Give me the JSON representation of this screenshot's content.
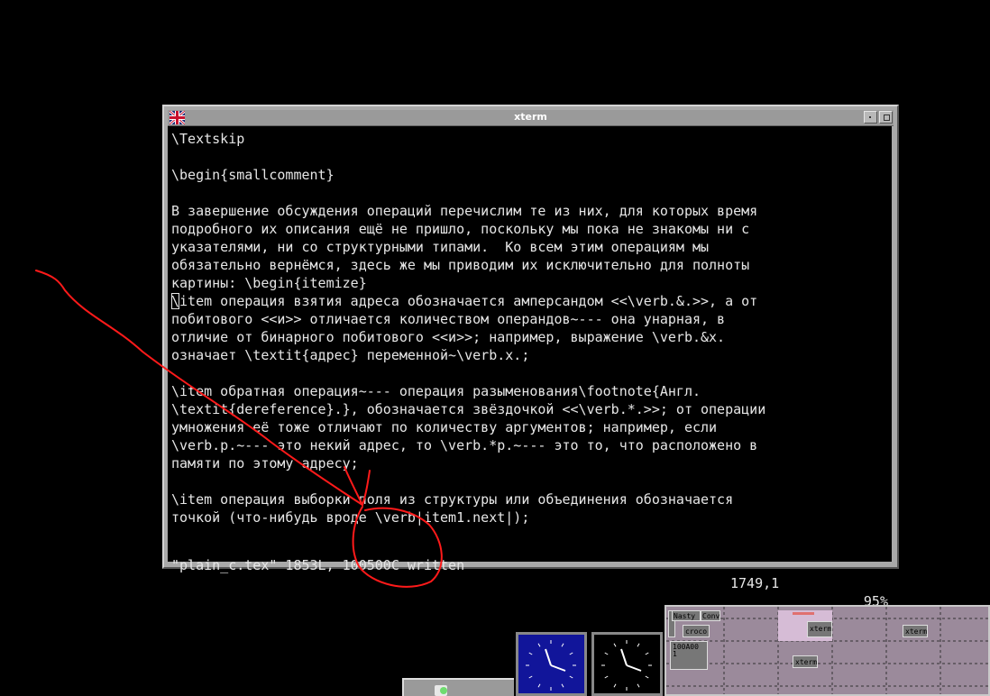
{
  "window": {
    "title": "xterm"
  },
  "terminal": {
    "lines": [
      "\\Textskip",
      "",
      "\\begin{smallcomment}",
      "",
      "В завершение обсуждения операций перечислим те из них, для которых время",
      "подробного их описания ещё не пришло, поскольку мы пока не знакомы ни с",
      "указателями, ни со структурными типами.  Ко всем этим операциям мы",
      "обязательно вернёмся, здесь же мы приводим их исключительно для полноты",
      "картины: \\begin{itemize}",
      "\\item операция взятия адреса обозначается амперсандом <<\\verb.&.>>, а от",
      "побитового <<и>> отличается количеством операндов~--- она унарная, в",
      "отличие от бинарного побитового <<и>>; например, выражение \\verb.&x.",
      "означает \\textit{адрес} переменной~\\verb.x.;",
      "",
      "\\item обратная операция~--- операция разыменования\\footnote{Англ.",
      "\\textit{dereference}.}, обозначается звёздочкой <<\\verb.*.>>; от операции",
      "умножения её тоже отличают по количеству аргументов; например, если",
      "\\verb.p.~--- это некий адрес, то \\verb.*p.~--- это то, что расположено в",
      "памяти по этому адресу;",
      "",
      "\\item операция выборки поля из структуры или объединения обозначается",
      "точкой (что-нибудь вроде \\verb|item1.next|);"
    ],
    "cursor_line": 9,
    "status": {
      "file": "\"plain_c.tex\" 1853L, 100500C written",
      "position": "1749,1",
      "percent": "95%"
    }
  },
  "pager": {
    "labels": [
      "Nasty",
      "Conv",
      "croco",
      "100A00 1",
      "xterm",
      "xterm",
      "xterm"
    ]
  },
  "colors": {
    "annotation": "#ff1a1a",
    "clock_blue_face": "#11159a",
    "pager_bg": "#9b8a9b"
  }
}
